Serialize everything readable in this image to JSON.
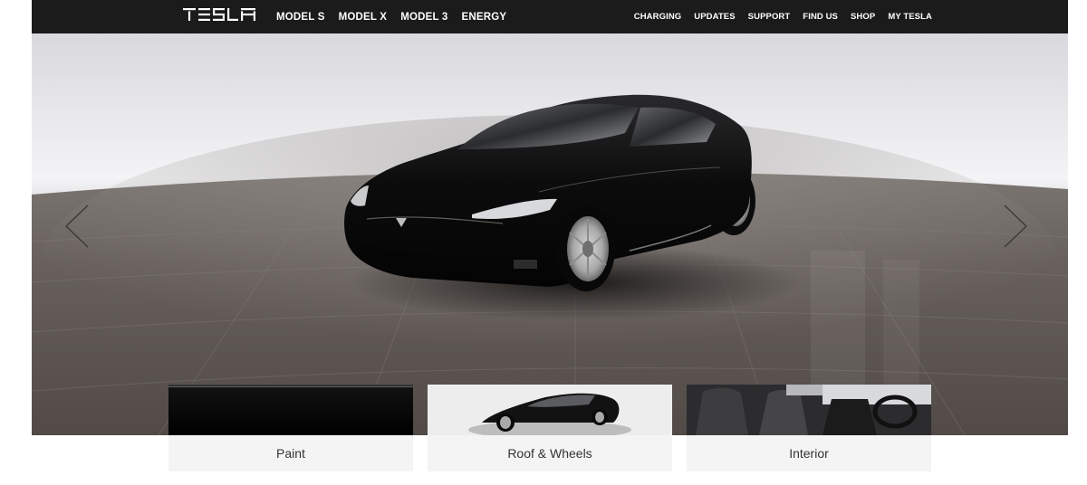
{
  "header": {
    "brand": "TESLA",
    "primary_nav": [
      "MODEL S",
      "MODEL X",
      "MODEL 3",
      "ENERGY"
    ],
    "secondary_nav": [
      "CHARGING",
      "UPDATES",
      "SUPPORT",
      "FIND US",
      "SHOP",
      "MY TESLA"
    ]
  },
  "options": {
    "paint": "Paint",
    "wheels": "Roof & Wheels",
    "interior": "Interior"
  },
  "colors": {
    "nav_background": "#1b1b1b",
    "nav_text": "#ffffff",
    "car_paint": "#0a0a0a",
    "card_background": "#f4f4f4"
  },
  "icons": {
    "left": "chevron-left-icon",
    "right": "chevron-right-icon"
  }
}
